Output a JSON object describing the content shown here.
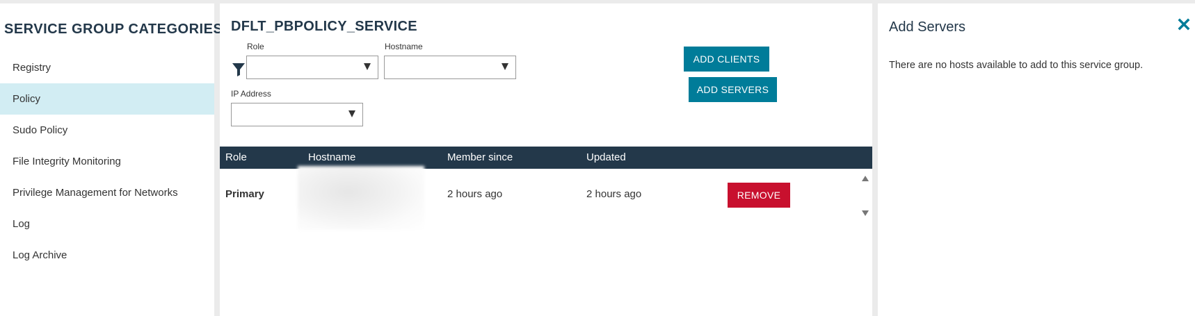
{
  "sidebar": {
    "title": "SERVICE GROUP CATEGORIES",
    "items": [
      {
        "label": "Registry"
      },
      {
        "label": "Policy"
      },
      {
        "label": "Sudo Policy"
      },
      {
        "label": "File Integrity Monitoring"
      },
      {
        "label": "Privilege Management for Networks"
      },
      {
        "label": "Log"
      },
      {
        "label": "Log Archive"
      }
    ],
    "active_item": "Policy"
  },
  "main": {
    "title": "DFLT_PBPOLICY_SERVICE",
    "filter_icon": "funnel-filter-icon",
    "filters": {
      "role": {
        "label": "Role",
        "value": ""
      },
      "hostname": {
        "label": "Hostname",
        "value": ""
      },
      "ip_address": {
        "label": "IP Address",
        "value": ""
      }
    },
    "buttons": {
      "add_clients": "ADD CLIENTS",
      "add_servers": "ADD SERVERS"
    },
    "table": {
      "columns": [
        "Role",
        "Hostname",
        "Member since",
        "Updated"
      ],
      "rows": [
        {
          "role": "Primary",
          "hostname": "",
          "member_since": "2 hours ago",
          "updated": "2 hours ago",
          "action": "REMOVE"
        }
      ]
    }
  },
  "right_panel": {
    "title": "Add Servers",
    "close_icon": "close-x-icon",
    "message": "There are no hosts available to add to this service group."
  },
  "colors": {
    "accent": "#007c99",
    "header_dark": "#23384a",
    "danger": "#c8102e",
    "active_highlight": "#d2edf3",
    "background": "#ebebeb"
  }
}
